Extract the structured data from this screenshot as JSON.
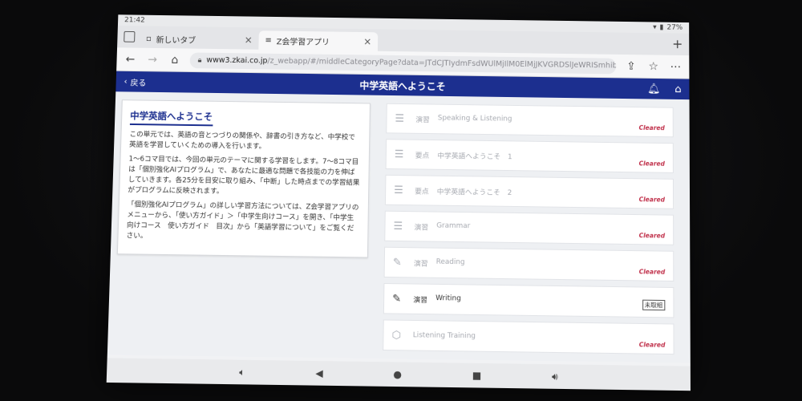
{
  "status": {
    "time": "21:42",
    "battery": "27%"
  },
  "tabs": [
    {
      "label": "新しいタブ"
    },
    {
      "label": "Z会学習アプリ"
    }
  ],
  "address": {
    "domain": "www3.zkai.co.jp",
    "path": "/z_webapp/#/middleCategoryPage?data=JTdCJTIydmFsdWUlMjIlM0ElMjJKVGRDSlJeWRISmhibk5KUkNVe"
  },
  "header": {
    "back_label": "戻る",
    "title": "中学英語へようこそ"
  },
  "intro": {
    "title": "中学英語へようこそ",
    "paragraphs": [
      "この単元では、英語の音とつづりの関係や、辞書の引き方など、中学校で英語を学習していくための導入を行います。",
      "1～6コマ目では、今回の単元のテーマに関する学習をします。7～8コマ目は「個別強化AIプログラム」で、あなたに最適な問題で各技能の力を伸ばしていきます。各25分を目安に取り組み、「中断」した時点までの学習結果がプログラムに反映されます。",
      "「個別強化AIプログラム」の詳しい学習方法については、Z会学習アプリのメニューから、「使い方ガイド」＞「中学生向けコース」を開き、「中学生向けコース　使い方ガイド　目次」から「英語学習について」をご覧ください。"
    ]
  },
  "items": [
    {
      "type": "演習",
      "title": "Speaking & Listening",
      "status": "Cleared"
    },
    {
      "type": "要点",
      "title": "中学英語へようこそ　1",
      "status": "Cleared"
    },
    {
      "type": "要点",
      "title": "中学英語へようこそ　2",
      "status": "Cleared"
    },
    {
      "type": "演習",
      "title": "Grammar",
      "status": "Cleared"
    },
    {
      "type": "演習",
      "title": "Reading",
      "status": "Cleared"
    },
    {
      "type": "演習",
      "title": "Writing",
      "status": "未取組"
    },
    {
      "type": "",
      "title": "Listening Training",
      "status": "Cleared"
    }
  ]
}
